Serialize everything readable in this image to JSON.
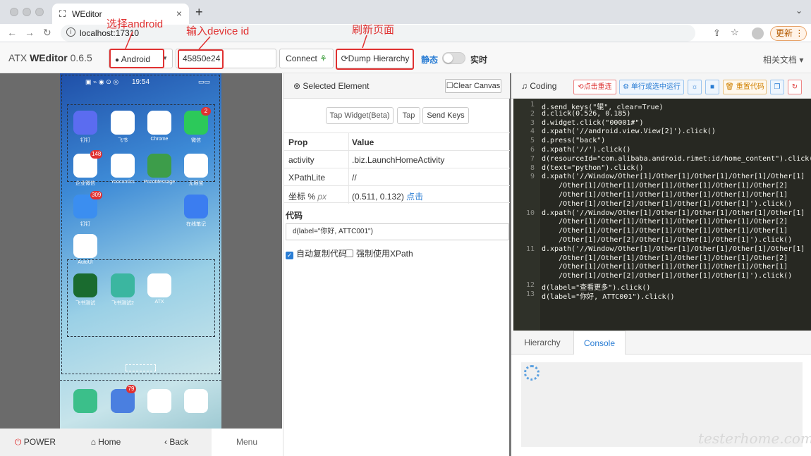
{
  "browser": {
    "tab_title": "WEditor",
    "url": "localhost:17310",
    "update_label": "更新"
  },
  "toolbar": {
    "brand_prefix": "ATX ",
    "brand_bold": "WEditor",
    "version": " 0.6.5",
    "platform": "Android",
    "device_id": "45850e24",
    "connect_label": "Connect",
    "dump_label": "Dump Hierarchy",
    "mode_static": "静态",
    "mode_realtime": "实时",
    "docs_label": "相关文档"
  },
  "annotations": {
    "select_android": "选择android",
    "input_device_id": "输入device id",
    "refresh_page": "刷新页面"
  },
  "phone": {
    "time": "19:54",
    "apps": [
      {
        "label": "钉钉",
        "color": "#5b6cf0",
        "icon": "app-icon-1"
      },
      {
        "label": "飞书",
        "color": "#ffffff",
        "icon": "app-icon-2"
      },
      {
        "label": "Chrome",
        "color": "#ffffff",
        "icon": "chrome-icon"
      },
      {
        "label": "微信",
        "color": "#2cc95a",
        "icon": "wechat-icon",
        "badge": "2"
      },
      {
        "label": "企业微信",
        "color": "#ffffff",
        "icon": "wework-icon",
        "badge": "148"
      },
      {
        "label": "Yoocomics",
        "color": "#ffffff",
        "icon": "app-icon-y"
      },
      {
        "label": "PocoMessage",
        "color": "#3d9d4a",
        "icon": "android-icon"
      },
      {
        "label": "无限宝",
        "color": "#ffffff",
        "icon": "app-icon-colorful"
      },
      {
        "label": "钉钉",
        "color": "#3b8ef0",
        "icon": "dingtalk-icon",
        "badge": "309"
      },
      {
        "label": "在线笔记",
        "color": "#3b7df0",
        "icon": "note-icon"
      },
      {
        "label": "AutoUI",
        "color": "#ffffff",
        "icon": "app-icon-green"
      },
      {
        "label": "飞书测试",
        "color": "#1a6b2f",
        "icon": "tree-icon"
      },
      {
        "label": "飞书测试2",
        "color": "#3bb6a0",
        "icon": "tree-icon-2"
      },
      {
        "label": "ATX",
        "color": "#ffffff",
        "icon": "atx-icon"
      }
    ],
    "dock": [
      {
        "color": "#3bbf8a",
        "icon": "phone-icon"
      },
      {
        "color": "#4a7fe0",
        "icon": "message-icon",
        "badge": "79"
      },
      {
        "color": "#ffffff",
        "icon": "browser-icon"
      },
      {
        "color": "#ffffff",
        "icon": "camera-icon"
      }
    ],
    "power_label": "POWER",
    "home_label": "Home",
    "back_label": "Back",
    "menu_label": "Menu"
  },
  "selected": {
    "title": "Selected Element",
    "clear_label": "Clear Canvas",
    "tap_widget": "Tap Widget(Beta)",
    "tap": "Tap",
    "send_keys": "Send Keys",
    "head_prop": "Prop",
    "head_value": "Value",
    "rows": [
      {
        "prop": "activity",
        "value": ".biz.LaunchHomeActivity"
      },
      {
        "prop": "XPathLite",
        "value": "//"
      },
      {
        "prop": "坐标 %",
        "unit": "px",
        "value": "(0.511, 0.132)",
        "link": "点击"
      }
    ],
    "code_label": "代码",
    "code_value": "d(label=\"你好, ATTC001\")",
    "auto_copy": "自动复制代码",
    "force_xpath": "强制使用XPath"
  },
  "coding": {
    "title": "Coding",
    "reconnect": "点击重连",
    "run_label": "单行或选中运行",
    "reset_code": "重置代码"
  },
  "code_lines": [
    "d.send_keys(\"辊\", clear=True)",
    "d.click(0.526, 0.185)",
    "d.widget.click(\"00001#\")",
    "d.xpath('//android.view.View[2]').click()",
    "d.press(\"back\")",
    "d.xpath('//').click()",
    "d(resourceId=\"com.alibaba.android.rimet:id/home_content\").click()",
    "d(text=\"python\").click()",
    "d.xpath('//Window/Other[1]/Other[1]/Other[1]/Other[1]/Other[1]",
    "    /Other[1]/Other[1]/Other[1]/Other[1]/Other[1]/Other[2]",
    "    /Other[1]/Other[1]/Other[1]/Other[1]/Other[1]/Other[1]",
    "    /Other[1]/Other[2]/Other[1]/Other[1]/Other[1]').click()",
    "d.xpath('//Window/Other[1]/Other[1]/Other[1]/Other[1]/Other[1]",
    "    /Other[1]/Other[1]/Other[1]/Other[1]/Other[1]/Other[2]",
    "    /Other[1]/Other[1]/Other[1]/Other[1]/Other[1]/Other[1]",
    "    /Other[1]/Other[2]/Other[1]/Other[1]/Other[1]').click()",
    "d.xpath('//Window/Other[1]/Other[1]/Other[1]/Other[1]/Other[1]",
    "    /Other[1]/Other[1]/Other[1]/Other[1]/Other[1]/Other[2]",
    "    /Other[1]/Other[1]/Other[1]/Other[1]/Other[1]/Other[1]",
    "    /Other[1]/Other[2]/Other[1]/Other[1]/Other[1]').click()",
    "d(label=\"查看更多\").click()",
    "d(label=\"你好, ATTC001\").click()"
  ],
  "line_numbers": [
    "1",
    "2",
    "3",
    "4",
    "5",
    "6",
    "7",
    "8",
    "9",
    "",
    "",
    "",
    "10",
    "",
    "",
    "",
    "11",
    "",
    "",
    "",
    "12",
    "13"
  ],
  "bottom_tabs": {
    "hierarchy": "Hierarchy",
    "console": "Console"
  },
  "watermark": "testerhome.com"
}
